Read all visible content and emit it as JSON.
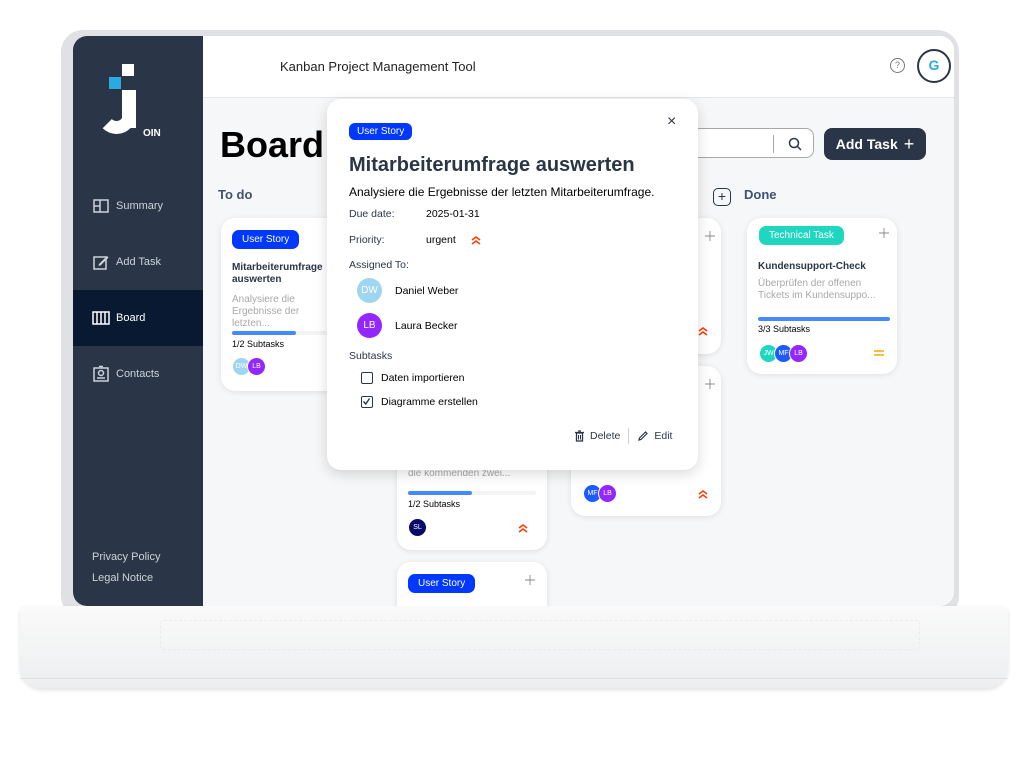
{
  "app": {
    "title": "Kanban Project Management Tool",
    "logo_text": "OIN",
    "user_initial": "G",
    "help_glyph": "?"
  },
  "sidebar": {
    "items": [
      {
        "label": "Summary",
        "icon": "summary-icon"
      },
      {
        "label": "Add Task",
        "icon": "add-task-icon"
      },
      {
        "label": "Board",
        "icon": "board-icon",
        "active": true
      },
      {
        "label": "Contacts",
        "icon": "contacts-icon"
      }
    ],
    "footer": [
      "Privacy Policy",
      "Legal Notice"
    ]
  },
  "board": {
    "title": "Board",
    "search_placeholder": "",
    "add_task_label": "Add Task",
    "columns": [
      "To do",
      "",
      "",
      "Done"
    ]
  },
  "cards": {
    "todo1": {
      "category": "User Story",
      "title": "Mitarbeiterumfrage auswerten",
      "desc": "Analysiere die Ergebnisse der letzten...",
      "subtasks": "1/2 Subtasks",
      "progress": 0.5,
      "assignees": [
        "DW",
        "LB"
      ]
    },
    "inprog1": {
      "desc": "die kommenden zwei...",
      "subtasks": "1/2 Subtasks",
      "progress": 0.5,
      "assignees": [
        "SL"
      ]
    },
    "inprog2": {
      "category": "User Story"
    },
    "await1": {
      "assignees": [
        "MF",
        "LB"
      ]
    },
    "done1": {
      "category": "Technical Task",
      "title": "Kundensupport-Check",
      "desc": "Überprüfen der offenen Tickets im Kundensuppo...",
      "subtasks": "3/3 Subtasks",
      "progress": 1.0,
      "assignees": [
        "JW",
        "MF",
        "LB"
      ]
    }
  },
  "modal": {
    "category": "User Story",
    "close_glyph": "×",
    "title": "Mitarbeiterumfrage auswerten",
    "description": "Analysiere die Ergebnisse der letzten Mitarbeiterumfrage.",
    "due_label": "Due date:",
    "due_value": "2025-01-31",
    "priority_label": "Priority:",
    "priority_value": "urgent",
    "assigned_label": "Assigned To:",
    "assignees": [
      {
        "initials": "DW",
        "name": "Daniel Weber",
        "color": "#9fd5f0"
      },
      {
        "initials": "LB",
        "name": "Laura Becker",
        "color": "#9327ff"
      }
    ],
    "subtasks_label": "Subtasks",
    "subtasks": [
      {
        "label": "Daten importieren",
        "done": false
      },
      {
        "label": "Diagramme erstellen",
        "done": true
      }
    ],
    "delete_label": "Delete",
    "edit_label": "Edit"
  },
  "colors": {
    "sidebar": "#2a3647",
    "accent_blue": "#0038ff",
    "teal": "#1fd7c1",
    "urgent": "#ff3d00",
    "medium": "#ffa800"
  }
}
